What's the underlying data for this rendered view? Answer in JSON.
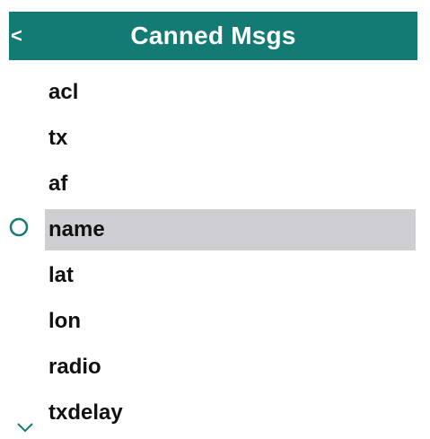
{
  "header": {
    "back_label": "<",
    "title": "Canned Msgs",
    "color": "#137a74"
  },
  "list": {
    "items": [
      {
        "label": "acl"
      },
      {
        "label": "tx"
      },
      {
        "label": "af"
      },
      {
        "label": "name",
        "selected": true
      },
      {
        "label": "lat"
      },
      {
        "label": "lon"
      },
      {
        "label": "radio"
      },
      {
        "label": "txdelay"
      }
    ]
  },
  "icons": {
    "cursor": "circle-cursor-icon",
    "more": "chevron-down-icon"
  },
  "colors": {
    "selected_bg": "#cfcfd3",
    "accent": "#137a74"
  }
}
